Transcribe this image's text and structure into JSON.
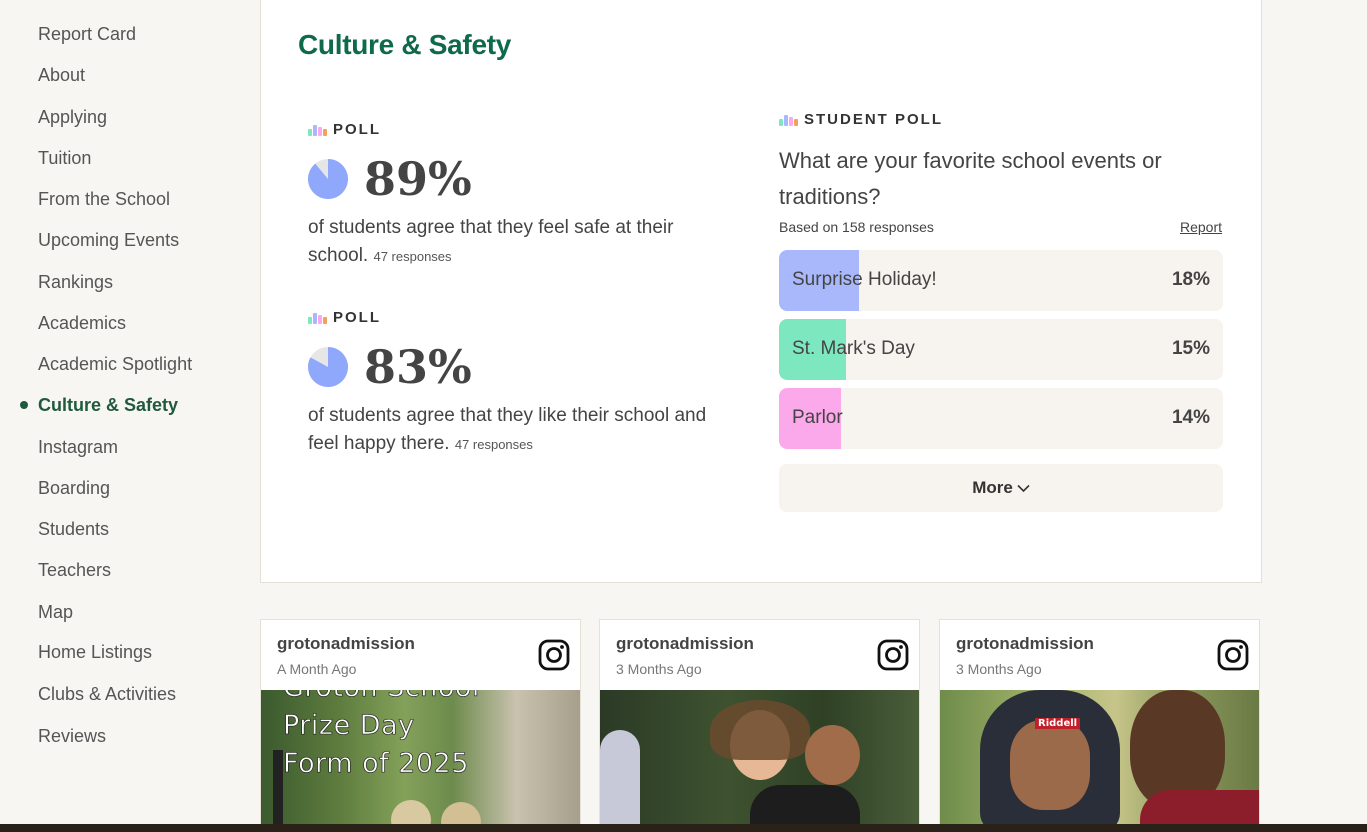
{
  "sidebar": {
    "items": [
      {
        "label": "Report Card"
      },
      {
        "label": "About"
      },
      {
        "label": "Applying"
      },
      {
        "label": "Tuition"
      },
      {
        "label": "From the School"
      },
      {
        "label": "Upcoming Events"
      },
      {
        "label": "Rankings"
      },
      {
        "label": "Academics"
      },
      {
        "label": "Academic Spotlight"
      },
      {
        "label": "Culture & Safety",
        "active": true
      },
      {
        "label": "Instagram"
      },
      {
        "label": "Boarding"
      },
      {
        "label": "Students"
      },
      {
        "label": "Teachers"
      },
      {
        "label": "Map"
      },
      {
        "label": "Home Listings"
      },
      {
        "label": "Clubs & Activities"
      },
      {
        "label": "Reviews"
      }
    ]
  },
  "section": {
    "title": "Culture & Safety"
  },
  "polls": [
    {
      "label": "POLL",
      "percent_text": "89%",
      "percent_value": 89,
      "description": "of students agree that they feel safe at their school.",
      "responses": "47 responses"
    },
    {
      "label": "POLL",
      "percent_text": "83%",
      "percent_value": 83,
      "description": "of students agree that they like their school and feel happy there.",
      "responses": "47 responses"
    }
  ],
  "student_poll": {
    "label": "STUDENT POLL",
    "question": "What are your favorite school events or traditions?",
    "based_on": "Based on 158 responses",
    "report_label": "Report",
    "options": [
      {
        "label": "Surprise Holiday!",
        "percent_text": "18%",
        "fill_fraction": 0.18,
        "color": "#a9b8fb"
      },
      {
        "label": "St. Mark's Day",
        "percent_text": "15%",
        "fill_fraction": 0.15,
        "color": "#7de8c0"
      },
      {
        "label": "Parlor",
        "percent_text": "14%",
        "fill_fraction": 0.14,
        "color": "#fba9ea"
      }
    ],
    "more_label": "More"
  },
  "instagram": {
    "posts": [
      {
        "user": "grotonadmission",
        "time": "A Month Ago",
        "photo_lines": [
          "Groton School",
          "Prize Day",
          "Form of 2025"
        ]
      },
      {
        "user": "grotonadmission",
        "time": "3 Months Ago"
      },
      {
        "user": "grotonadmission",
        "time": "3 Months Ago",
        "photo_text": "Riddell"
      }
    ]
  },
  "colors": {
    "accent_green": "#0e6a4b",
    "pie_fill": "#8fa8fb",
    "pie_rest": "#e6e6e6",
    "poll_icon": [
      "#7de8c0",
      "#a9b8fb",
      "#fba9ea",
      "#f5a05a"
    ]
  }
}
